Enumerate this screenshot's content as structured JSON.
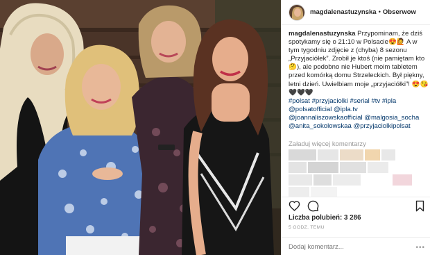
{
  "post": {
    "username": "magdalenastuzynska",
    "dot": "•",
    "follow_label": "Obserwow",
    "caption": {
      "username": "magdalenastuzynska",
      "text1": " Przypominam, że dziś spotykamy się o 21:10 w Polsacie",
      "emoji1": "😍🙋",
      "text2": " A w tym tygodniu zdjęcie z (chyba) 8 sezonu „Przyjaciółek”. Zrobił je ktoś (nie pamiętam kto",
      "emoji2": "🤔",
      "text3": "), ale podobno nie Hubert moim tabletem przed komórką domu Strzeleckich. Był piękny, letni dzień. Uwielbiam moje „przyjaciółki”! ",
      "emoji3": "😍😘🖤🖤🖤",
      "hashtags": "#polsat #przyjaciolki #serial #tv #ipla",
      "mentions1": "@polsatofficial @ipla.tv",
      "mentions2": "@joannaliszowskaofficial @malgosia_socha",
      "mentions3": "@anita_sokolowskaa @przyjaciolkipolsat"
    },
    "load_more_label": "Załaduj więcej komentarzy",
    "likes_label": "Liczba polubień: 3 286",
    "time_label": "5 GODZ. TEMU",
    "comment_placeholder": "Dodaj komentarz...",
    "more_label": "•••"
  },
  "colors": {
    "link": "#003569",
    "muted": "#999999",
    "text": "#262626",
    "border": "#efefef"
  },
  "icons": [
    "heart-icon",
    "comment-icon",
    "bookmark-icon",
    "more-options-icon"
  ]
}
